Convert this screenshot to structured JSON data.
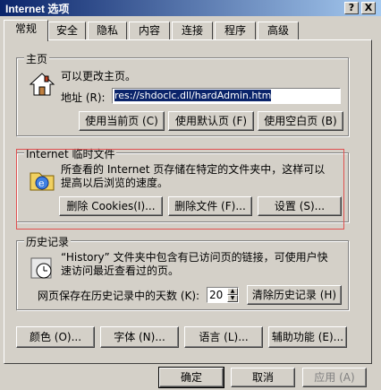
{
  "window": {
    "title": "Internet 选项",
    "help": "?",
    "close": "X"
  },
  "tabs": [
    "常规",
    "安全",
    "隐私",
    "内容",
    "连接",
    "程序",
    "高级"
  ],
  "home": {
    "group_label": "主页",
    "desc": "可以更改主页。",
    "address_label": "地址 (R):",
    "address_value": "res://shdoclc.dll/hardAdmin.htm",
    "btn_current": "使用当前页 (C)",
    "btn_default": "使用默认页 (F)",
    "btn_blank": "使用空白页 (B)"
  },
  "temp": {
    "group_label": "Internet 临时文件",
    "desc_line1": "所查看的 Internet 页存储在特定的文件夹中，这样可以",
    "desc_line2": "提高以后浏览的速度。",
    "btn_cookies": "删除 Cookies(I)...",
    "btn_files": "删除文件 (F)...",
    "btn_settings": "设置 (S)..."
  },
  "history": {
    "group_label": "历史记录",
    "desc_line1": "“History” 文件夹中包含有已访问页的链接，可使用户快",
    "desc_line2": "速访问最近查看过的页。",
    "days_label": "网页保存在历史记录中的天数 (K):",
    "days_value": "20",
    "btn_clear": "清除历史记录 (H)"
  },
  "bottom_buttons": {
    "colors": "颜色 (O)...",
    "fonts": "字体 (N)...",
    "languages": "语言 (L)...",
    "accessibility": "辅助功能 (E)..."
  },
  "dialog_buttons": {
    "ok": "确定",
    "cancel": "取消",
    "apply": "应用 (A)"
  }
}
